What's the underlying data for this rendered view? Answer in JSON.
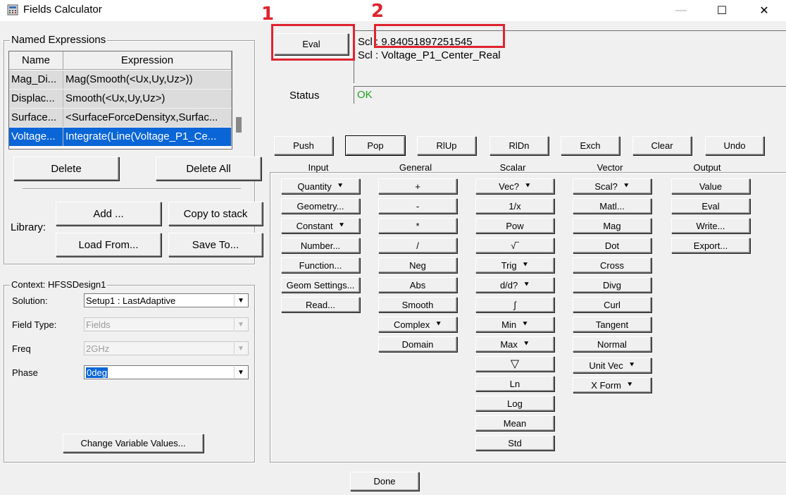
{
  "window": {
    "title": "Fields Calculator",
    "minimize": "—",
    "maximize": "☐",
    "close": "✕"
  },
  "named_expressions": {
    "title": "Named Expressions",
    "columns": [
      "Name",
      "Expression"
    ],
    "rows": [
      {
        "name": "Mag_Di...",
        "expression": "Mag(Smooth(<Ux,Uy,Uz>))"
      },
      {
        "name": "Displac...",
        "expression": "Smooth(<Ux,Uy,Uz>)"
      },
      {
        "name": "Surface...",
        "expression": "<SurfaceForceDensityx,Surfac..."
      },
      {
        "name": "Voltage...",
        "expression": "Integrate(Line(Voltage_P1_Ce..."
      }
    ],
    "delete_label": "Delete",
    "delete_all_label": "Delete All",
    "library_label": "Library:",
    "add_label": "Add ...",
    "copy_label": "Copy to stack",
    "load_label": "Load From...",
    "save_label": "Save To..."
  },
  "context": {
    "title": "Context: HFSSDesign1",
    "solution_label": "Solution:",
    "solution_value": "Setup1 : LastAdaptive",
    "field_type_label": "Field Type:",
    "field_type_value": "Fields",
    "freq_label": "Freq",
    "freq_value": "2GHz",
    "phase_label": "Phase",
    "phase_value": "0deg",
    "change_label": "Change Variable Values..."
  },
  "top": {
    "eval_label": "Eval",
    "output_lines": [
      "Scl : 9.84051897251545",
      "Scl : Voltage_P1_Center_Real"
    ],
    "status_label": "Status",
    "status_value": "OK",
    "annotation_1": "1",
    "annotation_2": "2"
  },
  "stack_buttons": [
    "Push",
    "Pop",
    "RlUp",
    "RlDn",
    "Exch",
    "Clear",
    "Undo"
  ],
  "columns": {
    "input": {
      "title": "Input",
      "items": [
        "Quantity",
        "Geometry...",
        "Constant",
        "Number...",
        "Function...",
        "Geom Settings...",
        "Read..."
      ]
    },
    "general": {
      "title": "General",
      "items": [
        "+",
        "-",
        "*",
        "/",
        "Neg",
        "Abs",
        "Smooth",
        "Complex",
        "Domain"
      ]
    },
    "scalar": {
      "title": "Scalar",
      "items": [
        "Vec?",
        "1/x",
        "Pow",
        "√‾",
        "Trig",
        "d/d?",
        "∫",
        "Min",
        "Max",
        "▽",
        "Ln",
        "Log",
        "Mean",
        "Std"
      ]
    },
    "vector": {
      "title": "Vector",
      "items": [
        "Scal?",
        "Matl...",
        "Mag",
        "Dot",
        "Cross",
        "Divg",
        "Curl",
        "Tangent",
        "Normal",
        "Unit Vec",
        "X Form"
      ]
    },
    "output": {
      "title": "Output",
      "items": [
        "Value",
        "Eval",
        "Write...",
        "Export..."
      ]
    }
  },
  "done_label": "Done"
}
